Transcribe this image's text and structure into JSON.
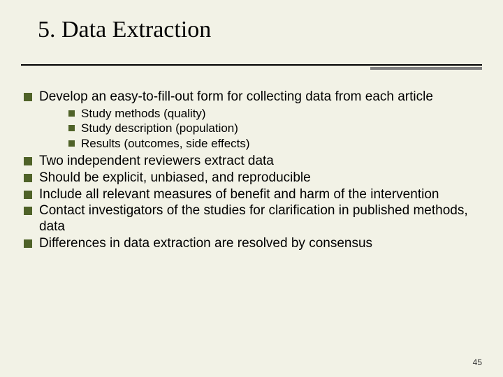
{
  "title": "5. Data Extraction",
  "bullets": [
    {
      "text": "Develop an easy-to-fill-out form for collecting data from each article",
      "sub": [
        "Study methods (quality)",
        "Study description (population)",
        "Results (outcomes, side effects)"
      ]
    },
    {
      "text": "Two independent reviewers extract data"
    },
    {
      "text": "Should be explicit, unbiased, and reproducible"
    },
    {
      "text": "Include all relevant measures of benefit and harm of the intervention"
    },
    {
      "text": "Contact investigators of the studies for clarification in published methods, data"
    },
    {
      "text": "Differences in data extraction are resolved by consensus"
    }
  ],
  "page_number": "45"
}
